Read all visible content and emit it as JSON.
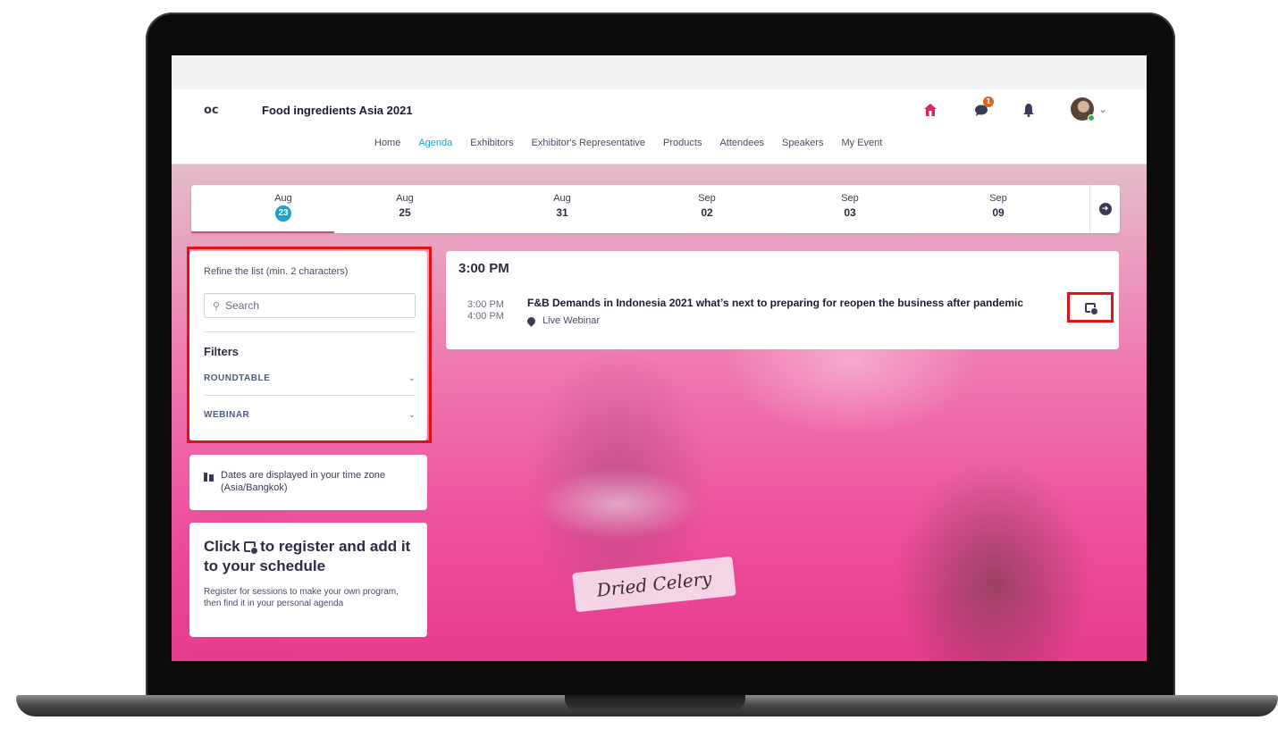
{
  "header": {
    "logo": "oc",
    "event_title": "Food ingredients Asia 2021",
    "nav": [
      {
        "label": "Home"
      },
      {
        "label": "Agenda"
      },
      {
        "label": "Exhibitors"
      },
      {
        "label": "Exhibitor's Representative"
      },
      {
        "label": "Products"
      },
      {
        "label": "Attendees"
      },
      {
        "label": "Speakers"
      },
      {
        "label": "My Event"
      }
    ],
    "active_nav": "Agenda",
    "notification_count": "1"
  },
  "dates": [
    {
      "month": "Aug",
      "day": "23",
      "selected": true
    },
    {
      "month": "Aug",
      "day": "25"
    },
    {
      "month": "Aug",
      "day": "31"
    },
    {
      "month": "Sep",
      "day": "02"
    },
    {
      "month": "Sep",
      "day": "03"
    },
    {
      "month": "Sep",
      "day": "09"
    }
  ],
  "filter_panel": {
    "refine_label": "Refine the list (min. 2 characters)",
    "search_placeholder": "Search",
    "filters_heading": "Filters",
    "filters": [
      "ROUNDTABLE",
      "WEBINAR"
    ]
  },
  "timezone_note": "Dates are displayed in your time zone (Asia/Bangkok)",
  "register_card": {
    "title_part1": "Click ",
    "title_part2": " to register and add it to your schedule",
    "description": "Register for sessions to make your own program, then find it in your personal agenda"
  },
  "session": {
    "time_heading": "3:00 PM",
    "start": "3:00 PM",
    "end": "4:00 PM",
    "title": "F&B Demands in Indonesia 2021 what’s next to preparing for reopen the business after pandemic",
    "location": "Live Webinar"
  },
  "background_label": "Dried Celery",
  "colors": {
    "accent": "#1aa3c8",
    "highlight_border": "#e11212",
    "background_pink": "#ee4e9b"
  }
}
